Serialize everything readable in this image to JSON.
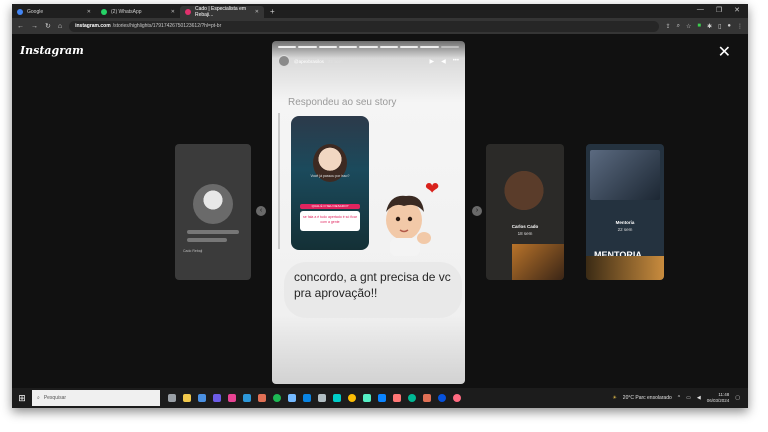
{
  "browser": {
    "tabs": [
      {
        "label": "Google",
        "color": "#4285F4",
        "active": false
      },
      {
        "label": "(2) WhatsApp",
        "color": "#25D366",
        "active": false
      },
      {
        "label": "Cado | Especialista em Rebaji...",
        "color": "#E1306C",
        "active": true
      }
    ],
    "url_host": "instagram.com",
    "url_path": "/stories/highlights/17917426750123612/?hl=pt-br"
  },
  "instagram": {
    "logo": "Instagram",
    "story": {
      "username": "@apexbrasilos",
      "time": "22 sem",
      "replied_label": "Respondeu ao seu story",
      "message": "concordo, a gnt precisa de vc pra aprovação!!",
      "mini_caption": "Você já passou por isso?",
      "mini_button": "QUAL É O SEU DESAFIO?",
      "mini_box": "se fala a é tudo apertado é só ficar com a gente"
    },
    "side_stories": {
      "left_caption": "Cado Rebaji",
      "middle_name": "Carlos Cado",
      "middle_time": "18 sem",
      "right_name": "Mentoria",
      "right_time": "22 sem",
      "right_title": "MENTORIA"
    }
  },
  "taskbar": {
    "search_placeholder": "Pesquisar",
    "weather": "20°C Parc ensolarado",
    "time": "11:48",
    "date": "06/03/2024"
  }
}
